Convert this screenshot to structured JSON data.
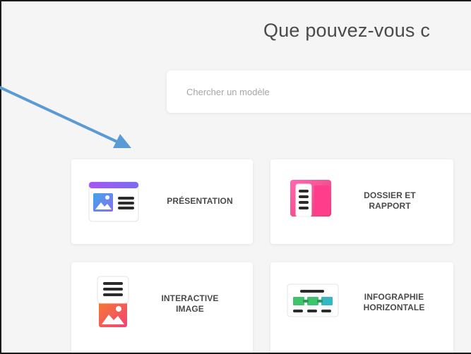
{
  "page": {
    "title": "Que pouvez-vous c"
  },
  "search": {
    "placeholder": "Chercher un modèle"
  },
  "templates": [
    {
      "label": "PRÉSENTATION",
      "icon": "presentation-icon"
    },
    {
      "label": "DOSSIER ET RAPPORT",
      "icon": "document-icon"
    },
    {
      "label": "INTERACTIVE IMAGE",
      "icon": "interactive-image-icon"
    },
    {
      "label": "INFOGRAPHIE HORIZONTALE",
      "icon": "horizontal-infographic-icon"
    }
  ],
  "colors": {
    "arrow": "#5b9bd5",
    "text": "#4a4a4a",
    "background": "#f5f5f5",
    "card": "#ffffff",
    "presentation_top": "#8b5cf6",
    "document_pink": "#f0227a",
    "image_orange": "#f5653b",
    "infographic_green": "#3ec46d"
  }
}
